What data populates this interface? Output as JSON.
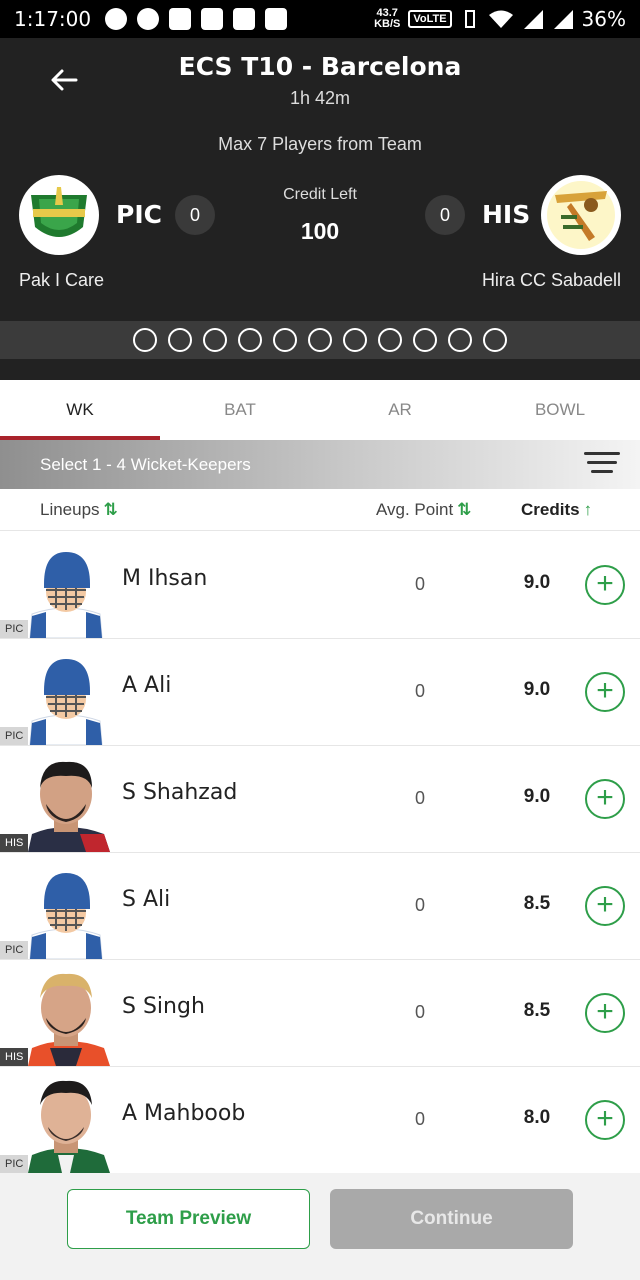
{
  "status_bar": {
    "time": "1:17:00",
    "speed_value": "43.7",
    "speed_unit": "KB/S",
    "volte": "VoLTE",
    "battery": "36%"
  },
  "header": {
    "match_title": "ECS T10 - Barcelona",
    "time_left": "1h 42m",
    "max_players": "Max 7 Players from Team",
    "credit_label": "Credit Left",
    "credit_value": "100",
    "team_left": {
      "code": "PIC",
      "name": "Pak I Care",
      "count": "0"
    },
    "team_right": {
      "code": "HIS",
      "name": "Hira CC Sabadell",
      "count": "0"
    }
  },
  "tabs": [
    {
      "label": "WK",
      "active": true
    },
    {
      "label": "BAT",
      "active": false
    },
    {
      "label": "AR",
      "active": false
    },
    {
      "label": "BOWL",
      "active": false
    }
  ],
  "select_hint": "Select 1 - 4 Wicket-Keepers",
  "columns": {
    "lineups": "Lineups",
    "avg_point": "Avg. Point",
    "credits": "Credits"
  },
  "players": [
    {
      "name": "M Ihsan",
      "team": "PIC",
      "avg_point": "0",
      "credits": "9.0",
      "avatar": "helmet"
    },
    {
      "name": "A Ali",
      "team": "PIC",
      "avg_point": "0",
      "credits": "9.0",
      "avatar": "helmet"
    },
    {
      "name": "S Shahzad",
      "team": "HIS",
      "avg_point": "0",
      "credits": "9.0",
      "avatar": "photo-red"
    },
    {
      "name": "S Ali",
      "team": "PIC",
      "avg_point": "0",
      "credits": "8.5",
      "avatar": "helmet"
    },
    {
      "name": "S Singh",
      "team": "HIS",
      "avg_point": "0",
      "credits": "8.5",
      "avatar": "photo-orange"
    },
    {
      "name": "A Mahboob",
      "team": "PIC",
      "avg_point": "0",
      "credits": "8.0",
      "avatar": "photo-green"
    }
  ],
  "footer": {
    "preview_label": "Team Preview",
    "continue_label": "Continue"
  },
  "colors": {
    "header_bg": "#222222",
    "accent_red": "#a9232b",
    "accent_green": "#2e9e49"
  }
}
